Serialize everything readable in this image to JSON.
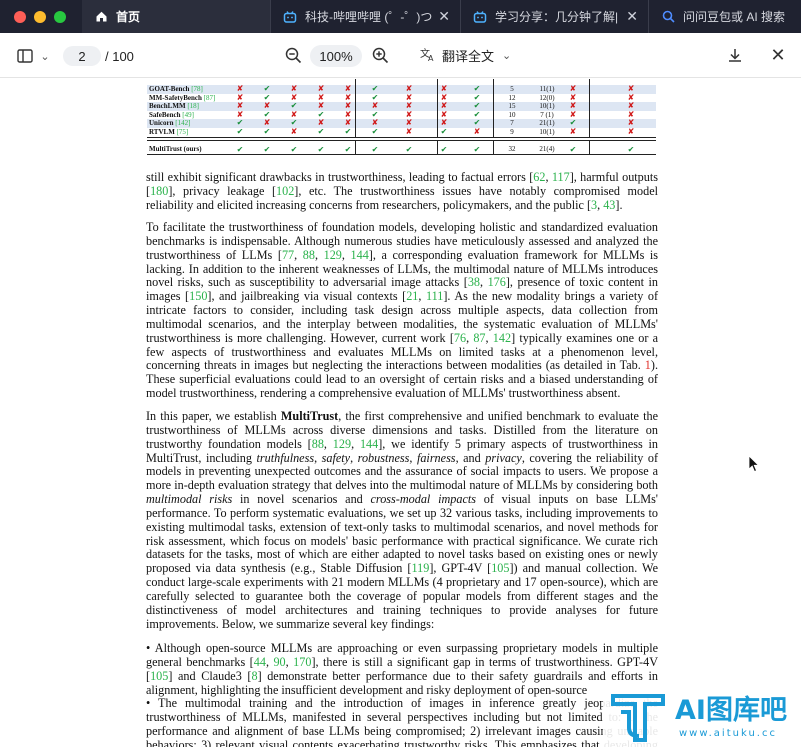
{
  "tabs": [
    {
      "label": "首页",
      "icon": "home-icon"
    },
    {
      "label": "科技-哔哩哔哩 (゜-゜)つ",
      "icon": "bilibili-icon"
    },
    {
      "label": "学习分享：几分钟了解|",
      "icon": "bilibili-icon"
    },
    {
      "label": "问问豆包或 AI 搜索",
      "icon": "search-icon"
    }
  ],
  "toolbar": {
    "current_page": "2",
    "total_pages": "/ 100",
    "zoom": "100%",
    "translate_label": "翻译全文"
  },
  "table": {
    "rows": [
      {
        "name": "GOAT-Bench",
        "ref": "78",
        "marks": [
          "x",
          "v",
          "x",
          "x",
          "x",
          "v",
          "x",
          "x",
          "v"
        ],
        "tasks": "5",
        "models": "11(1)",
        "m1": "x",
        "m2": "x",
        "shade": true
      },
      {
        "name": "MM-SafetyBench",
        "ref": "87",
        "marks": [
          "x",
          "v",
          "x",
          "x",
          "x",
          "v",
          "x",
          "x",
          "v"
        ],
        "tasks": "12",
        "models": "12(0)",
        "m1": "x",
        "m2": "x",
        "shade": false
      },
      {
        "name": "BenchLMM",
        "ref": "18",
        "marks": [
          "x",
          "x",
          "v",
          "x",
          "x",
          "x",
          "x",
          "x",
          "v"
        ],
        "tasks": "15",
        "models": "10(1)",
        "m1": "x",
        "m2": "x",
        "shade": true
      },
      {
        "name": "SafeBench",
        "ref": "49",
        "marks": [
          "x",
          "v",
          "x",
          "v",
          "x",
          "v",
          "x",
          "x",
          "v"
        ],
        "tasks": "10",
        "models": "7 (1)",
        "m1": "x",
        "m2": "x",
        "shade": false
      },
      {
        "name": "Unicorn",
        "ref": "142",
        "marks": [
          "v",
          "x",
          "v",
          "x",
          "x",
          "x",
          "x",
          "x",
          "v"
        ],
        "tasks": "7",
        "models": "21(1)",
        "m1": "v",
        "m2": "x",
        "shade": true
      },
      {
        "name": "RTVLM",
        "ref": "75",
        "marks": [
          "v",
          "v",
          "x",
          "v",
          "v",
          "v",
          "x",
          "v",
          "x"
        ],
        "tasks": "9",
        "models": "10(1)",
        "m1": "x",
        "m2": "x",
        "shade": false
      }
    ],
    "ours": {
      "name": "MultiTrust (ours)",
      "marks": [
        "v",
        "v",
        "v",
        "v",
        "v",
        "v",
        "v",
        "v",
        "v"
      ],
      "tasks": "32",
      "models": "21(4)",
      "m1": "v",
      "m2": "v"
    }
  },
  "paragraphs": [
    "still exhibit significant drawbacks in trustworthiness, leading to factual errors [62, 117], harmful outputs [180], privacy leakage [102], etc. The trustworthiness issues have notably compromised model reliability and elicited increasing concerns from researchers, policymakers, and the public [3, 43].",
    "To facilitate the trustworthiness of foundation models, developing holistic and standardized evaluation benchmarks is indispensable. Although numerous studies have meticulously assessed and analyzed the trustworthiness of LLMs [77, 88, 129, 144], a corresponding evaluation framework for MLLMs is lacking. In addition to the inherent weaknesses of LLMs, the multimodal nature of MLLMs introduces novel risks, such as susceptibility to adversarial image attacks [38, 176], presence of toxic content in images [150], and jailbreaking via visual contexts [21, 111]. As the new modality brings a variety of intricate factors to consider, including task design across multiple aspects, data collection from multimodal scenarios, and the interplay between modalities, the systematic evaluation of MLLMs' trustworthiness is more challenging. However, current work [76, 87, 142] typically examines one or a few aspects of trustworthiness and evaluates MLLMs on limited tasks at a phenomenon level, concerning threats in images but neglecting the interactions between modalities (as detailed in Tab. 1). These superficial evaluations could lead to an oversight of certain risks and a biased understanding of model trustworthiness, rendering a comprehensive evaluation of MLLMs' trustworthiness absent.",
    "In this paper, we establish MultiTrust, the first comprehensive and unified benchmark to evaluate the trustworthiness of MLLMs across diverse dimensions and tasks. Distilled from the literature on trustworthy foundation models [88, 129, 144], we identify 5 primary aspects of trustworthiness in MultiTrust, including truthfulness, safety, robustness, fairness, and privacy, covering the reliability of models in preventing unexpected outcomes and the assurance of social impacts to users. We propose a more in-depth evaluation strategy that delves into the multimodal nature of MLLMs by considering both multimodal risks in novel scenarios and cross-modal impacts of visual inputs on base LLMs' performance. To perform systematic evaluations, we set up 32 various tasks, including improvements to existing multimodal tasks, extension of text-only tasks to multimodal scenarios, and novel methods for risk assessment, which focus on models' basic performance with practical significance. We curate rich datasets for the tasks, most of which are either adapted to novel tasks based on existing ones or newly proposed via data synthesis (e.g., Stable Diffusion [119], GPT-4V [105]) and manual collection. We conduct large-scale experiments with 21 modern MLLMs (4 proprietary and 17 open-source), which are carefully selected to guarantee both the coverage of popular models from different stages and the distinctiveness of model architectures and training techniques to provide analyses for future improvements. Below, we summarize several key findings:",
    "• Although open-source MLLMs are approaching or even surpassing proprietary models in multiple general benchmarks [44, 90, 170], there is still a significant gap in terms of trustworthiness. GPT-4V [105] and Claude3 [8] demonstrate better performance due to their safety guardrails and efforts in alignment, highlighting the insufficient development and risky deployment of open-source",
    "• The multimodal training and the introduction of images in inference greatly jeopardize the trustworthiness of MLLMs, manifested in several perspectives including but not limited to: 1) the performance and alignment of base LLMs being compromised; 2) irrelevant images causing unstable behaviors; 3) relevant visual contents exacerbating trustworthy risks. This emphasizes that developing trustworthy"
  ],
  "watermark": {
    "title": "AI图库吧",
    "url": "www.aituku.cc"
  }
}
